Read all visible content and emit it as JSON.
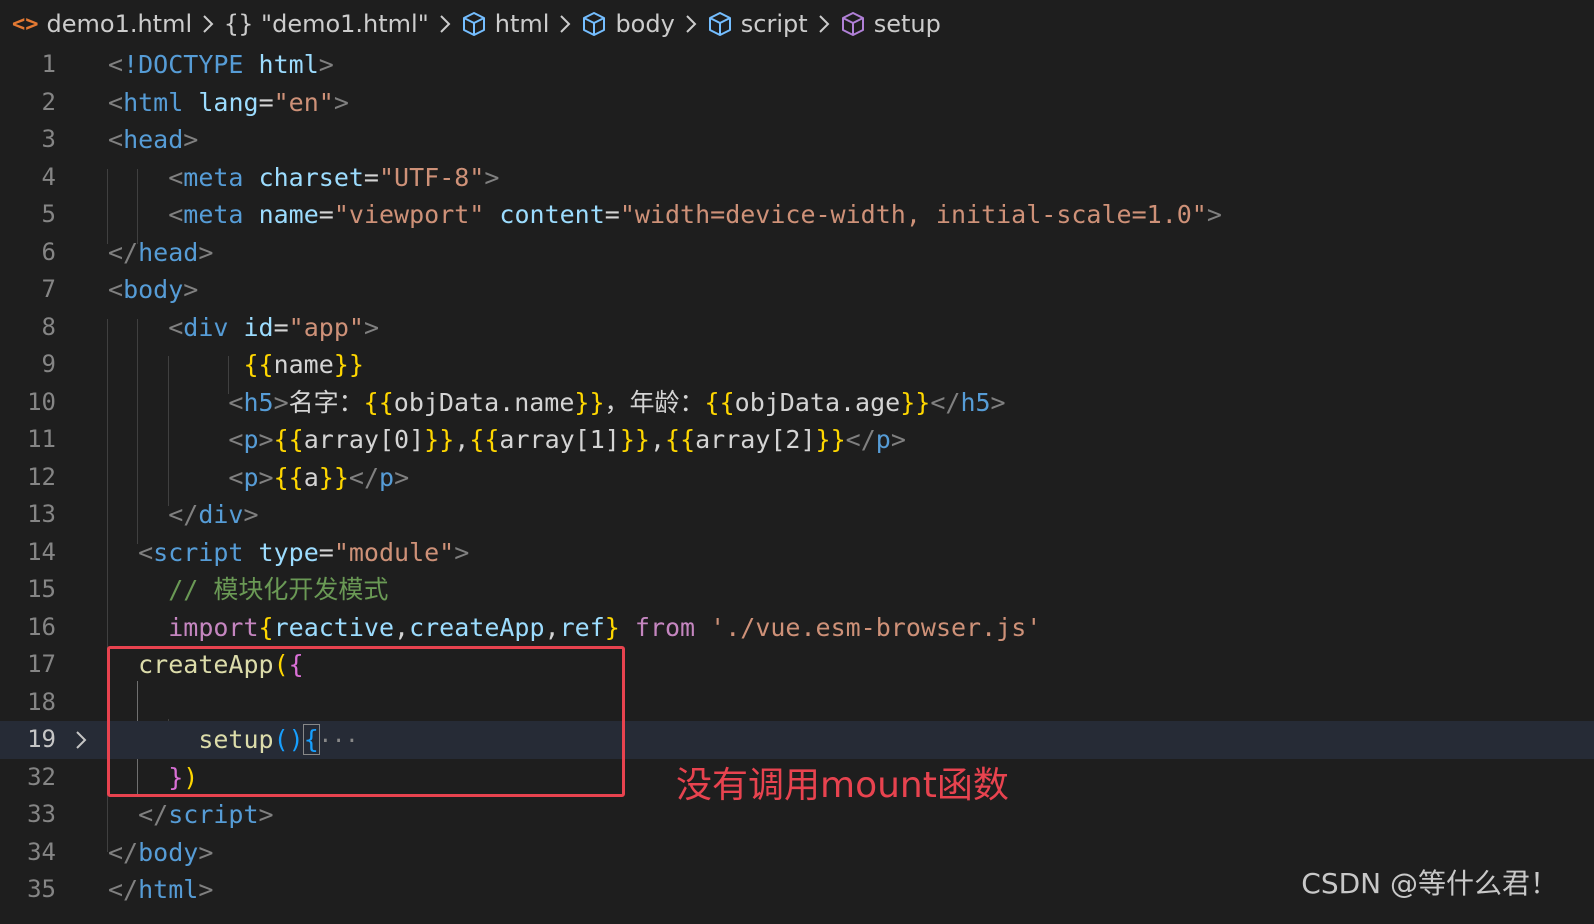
{
  "breadcrumb": [
    {
      "icon": "html-file-icon",
      "label": "demo1.html"
    },
    {
      "icon": "object-braces-icon",
      "label": "\"demo1.html\""
    },
    {
      "icon": "element-cube-icon",
      "label": "html"
    },
    {
      "icon": "element-cube-icon",
      "label": "body"
    },
    {
      "icon": "element-cube-icon",
      "label": "script"
    },
    {
      "icon": "method-cube-icon",
      "label": "setup"
    }
  ],
  "lines": [
    {
      "num": "1",
      "tokens": [
        [
          "t-punct",
          "<"
        ],
        [
          "t-tag",
          "!DOCTYPE"
        ],
        [
          "t-txt",
          " "
        ],
        [
          "t-attr",
          "html"
        ],
        [
          "t-punct",
          ">"
        ]
      ]
    },
    {
      "num": "2",
      "tokens": [
        [
          "t-punct",
          "<"
        ],
        [
          "t-tag",
          "html"
        ],
        [
          "t-txt",
          " "
        ],
        [
          "t-attr",
          "lang"
        ],
        [
          "t-txt",
          "="
        ],
        [
          "t-str",
          "\"en\""
        ],
        [
          "t-punct",
          ">"
        ]
      ]
    },
    {
      "num": "3",
      "tokens": [
        [
          "t-punct",
          "<"
        ],
        [
          "t-tag",
          "head"
        ],
        [
          "t-punct",
          ">"
        ]
      ]
    },
    {
      "num": "4",
      "tokens": [
        [
          "t-txt",
          "    "
        ],
        [
          "t-punct",
          "<"
        ],
        [
          "t-tag",
          "meta"
        ],
        [
          "t-txt",
          " "
        ],
        [
          "t-attr",
          "charset"
        ],
        [
          "t-txt",
          "="
        ],
        [
          "t-str",
          "\"UTF-8\""
        ],
        [
          "t-punct",
          ">"
        ]
      ]
    },
    {
      "num": "5",
      "tokens": [
        [
          "t-txt",
          "    "
        ],
        [
          "t-punct",
          "<"
        ],
        [
          "t-tag",
          "meta"
        ],
        [
          "t-txt",
          " "
        ],
        [
          "t-attr",
          "name"
        ],
        [
          "t-txt",
          "="
        ],
        [
          "t-str",
          "\"viewport\""
        ],
        [
          "t-txt",
          " "
        ],
        [
          "t-attr",
          "content"
        ],
        [
          "t-txt",
          "="
        ],
        [
          "t-str",
          "\"width=device-width, initial-scale=1.0\""
        ],
        [
          "t-punct",
          ">"
        ]
      ]
    },
    {
      "num": "6",
      "tokens": [
        [
          "t-punct",
          "</"
        ],
        [
          "t-tag",
          "head"
        ],
        [
          "t-punct",
          ">"
        ]
      ]
    },
    {
      "num": "7",
      "tokens": [
        [
          "t-punct",
          "<"
        ],
        [
          "t-tag",
          "body"
        ],
        [
          "t-punct",
          ">"
        ]
      ]
    },
    {
      "num": "8",
      "tokens": [
        [
          "t-txt",
          "    "
        ],
        [
          "t-punct",
          "<"
        ],
        [
          "t-tag",
          "div"
        ],
        [
          "t-txt",
          " "
        ],
        [
          "t-attr",
          "id"
        ],
        [
          "t-txt",
          "="
        ],
        [
          "t-str",
          "\"app\""
        ],
        [
          "t-punct",
          ">"
        ]
      ]
    },
    {
      "num": "9",
      "tokens": [
        [
          "t-txt",
          "         "
        ],
        [
          "t-brace1",
          "{{"
        ],
        [
          "t-txt",
          "name"
        ],
        [
          "t-brace1",
          "}}"
        ]
      ]
    },
    {
      "num": "10",
      "tokens": [
        [
          "t-txt",
          "        "
        ],
        [
          "t-punct",
          "<"
        ],
        [
          "t-tag",
          "h5"
        ],
        [
          "t-punct",
          ">"
        ],
        [
          "t-txt",
          "名字："
        ],
        [
          "t-brace1",
          "{{"
        ],
        [
          "t-txt",
          "objData.name"
        ],
        [
          "t-brace1",
          "}}"
        ],
        [
          "t-txt",
          "，年龄："
        ],
        [
          "t-brace1",
          "{{"
        ],
        [
          "t-txt",
          "objData.age"
        ],
        [
          "t-brace1",
          "}}"
        ],
        [
          "t-punct",
          "</"
        ],
        [
          "t-tag",
          "h5"
        ],
        [
          "t-punct",
          ">"
        ]
      ]
    },
    {
      "num": "11",
      "tokens": [
        [
          "t-txt",
          "        "
        ],
        [
          "t-punct",
          "<"
        ],
        [
          "t-tag",
          "p"
        ],
        [
          "t-punct",
          ">"
        ],
        [
          "t-brace1",
          "{{"
        ],
        [
          "t-txt",
          "array[0]"
        ],
        [
          "t-brace1",
          "}}"
        ],
        [
          "t-txt",
          ","
        ],
        [
          "t-brace1",
          "{{"
        ],
        [
          "t-txt",
          "array[1]"
        ],
        [
          "t-brace1",
          "}}"
        ],
        [
          "t-txt",
          ","
        ],
        [
          "t-brace1",
          "{{"
        ],
        [
          "t-txt",
          "array[2]"
        ],
        [
          "t-brace1",
          "}}"
        ],
        [
          "t-punct",
          "</"
        ],
        [
          "t-tag",
          "p"
        ],
        [
          "t-punct",
          ">"
        ]
      ]
    },
    {
      "num": "12",
      "tokens": [
        [
          "t-txt",
          "        "
        ],
        [
          "t-punct",
          "<"
        ],
        [
          "t-tag",
          "p"
        ],
        [
          "t-punct",
          ">"
        ],
        [
          "t-brace1",
          "{{"
        ],
        [
          "t-txt",
          "a"
        ],
        [
          "t-brace1",
          "}}"
        ],
        [
          "t-punct",
          "</"
        ],
        [
          "t-tag",
          "p"
        ],
        [
          "t-punct",
          ">"
        ]
      ]
    },
    {
      "num": "13",
      "tokens": [
        [
          "t-txt",
          "    "
        ],
        [
          "t-punct",
          "</"
        ],
        [
          "t-tag",
          "div"
        ],
        [
          "t-punct",
          ">"
        ]
      ]
    },
    {
      "num": "14",
      "tokens": [
        [
          "t-txt",
          "  "
        ],
        [
          "t-punct",
          "<"
        ],
        [
          "t-tag",
          "script"
        ],
        [
          "t-txt",
          " "
        ],
        [
          "t-attr",
          "type"
        ],
        [
          "t-txt",
          "="
        ],
        [
          "t-str",
          "\"module\""
        ],
        [
          "t-punct",
          ">"
        ]
      ]
    },
    {
      "num": "15",
      "tokens": [
        [
          "t-txt",
          "    "
        ],
        [
          "t-cmt",
          "// 模块化开发模式"
        ]
      ]
    },
    {
      "num": "16",
      "tokens": [
        [
          "t-txt",
          "    "
        ],
        [
          "t-kw",
          "import"
        ],
        [
          "t-brace1",
          "{"
        ],
        [
          "t-var",
          "reactive"
        ],
        [
          "t-txt",
          ","
        ],
        [
          "t-var",
          "createApp"
        ],
        [
          "t-txt",
          ","
        ],
        [
          "t-var",
          "ref"
        ],
        [
          "t-brace1",
          "}"
        ],
        [
          "t-txt",
          " "
        ],
        [
          "t-kw",
          "from"
        ],
        [
          "t-txt",
          " "
        ],
        [
          "t-str",
          "'./vue.esm-browser.js'"
        ]
      ]
    },
    {
      "num": "17",
      "tokens": [
        [
          "t-txt",
          "  "
        ],
        [
          "t-func",
          "createApp"
        ],
        [
          "t-brace1",
          "("
        ],
        [
          "t-brace2",
          "{"
        ]
      ]
    },
    {
      "num": "18",
      "tokens": []
    },
    {
      "num": "19",
      "tokens": [
        [
          "t-txt",
          "      "
        ],
        [
          "t-func",
          "setup"
        ],
        [
          "t-brace3",
          "()"
        ],
        [
          "t-brace3 cursor-box",
          "{"
        ],
        [
          "t-ellipsis",
          "···"
        ]
      ],
      "current": true,
      "folded": true
    },
    {
      "num": "32",
      "tokens": [
        [
          "t-txt",
          "    "
        ],
        [
          "t-brace2",
          "}"
        ],
        [
          "t-brace1",
          ")"
        ]
      ]
    },
    {
      "num": "33",
      "tokens": [
        [
          "t-txt",
          "  "
        ],
        [
          "t-punct",
          "</"
        ],
        [
          "t-tag",
          "script"
        ],
        [
          "t-punct",
          ">"
        ]
      ]
    },
    {
      "num": "34",
      "tokens": [
        [
          "t-punct",
          "</"
        ],
        [
          "t-tag",
          "body"
        ],
        [
          "t-punct",
          ">"
        ]
      ]
    },
    {
      "num": "35",
      "tokens": [
        [
          "t-punct",
          "</"
        ],
        [
          "t-tag",
          "html"
        ],
        [
          "t-punct",
          ">"
        ]
      ]
    }
  ],
  "annotation": "没有调用mount函数",
  "watermark": "CSDN @等什么君！",
  "colors": {
    "background": "#1e1e1e",
    "highlight_border": "#e8434f",
    "annotation_text": "#e8434f"
  }
}
